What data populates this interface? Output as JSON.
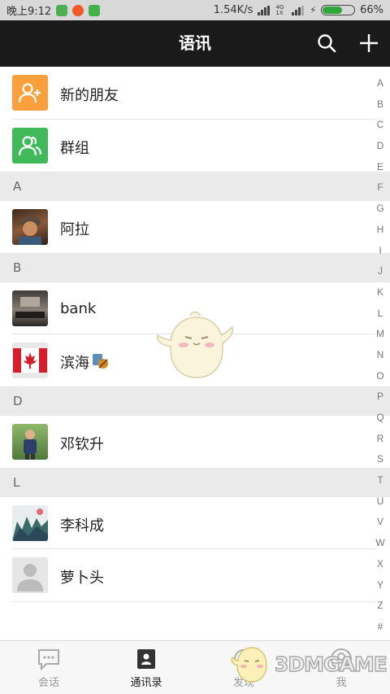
{
  "status_bar": {
    "time": "晚上9:12",
    "network_speed": "1.54K/s",
    "signal_small": "4G 1X",
    "battery_percent": "66%",
    "battery_level": 0.66
  },
  "header": {
    "title": "语讯",
    "search_icon": "search-icon",
    "add_icon": "plus-icon"
  },
  "contacts": {
    "new_friends": "新的朋友",
    "groups": "群组",
    "sections": [
      {
        "letter": "A",
        "items": [
          "阿拉"
        ]
      },
      {
        "letter": "B",
        "items": [
          "bank",
          "滨海"
        ]
      },
      {
        "letter": "D",
        "items": [
          "邓钦升"
        ]
      },
      {
        "letter": "L",
        "items": [
          "李科成",
          "萝卜头"
        ]
      }
    ]
  },
  "index_bar": [
    "A",
    "B",
    "C",
    "D",
    "E",
    "F",
    "G",
    "H",
    "I",
    "J",
    "K",
    "L",
    "M",
    "N",
    "O",
    "P",
    "Q",
    "R",
    "S",
    "T",
    "U",
    "V",
    "W",
    "X",
    "Y",
    "Z",
    "#"
  ],
  "bottom_nav": {
    "tabs": [
      {
        "label": "会话",
        "icon": "chat-icon"
      },
      {
        "label": "通讯录",
        "icon": "contacts-icon"
      },
      {
        "label": "发现",
        "icon": "discover-icon"
      },
      {
        "label": "我",
        "icon": "profile-icon"
      }
    ]
  },
  "watermark": "3DMGAME",
  "colors": {
    "header_bg": "#1a1a1a",
    "new_friends": "#f9a03c",
    "groups": "#3fb95a",
    "section_bg": "#eaeaea"
  }
}
